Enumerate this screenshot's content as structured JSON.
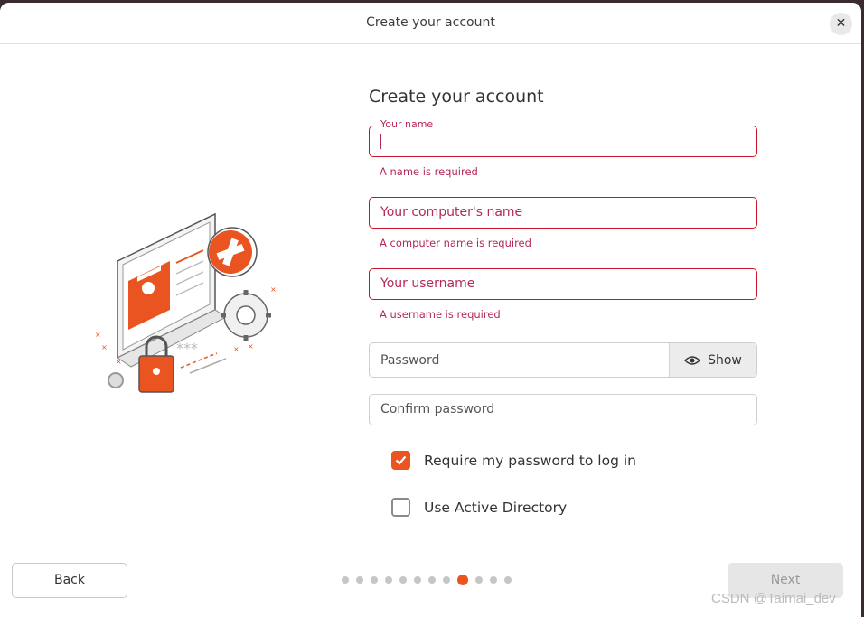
{
  "window": {
    "title": "Create your account"
  },
  "form": {
    "heading": "Create your account",
    "name": {
      "label": "Your name",
      "value": "",
      "error": "A name is required"
    },
    "computer": {
      "placeholder": "Your computer's name",
      "error": "A computer name is required"
    },
    "username": {
      "placeholder": "Your username",
      "error": "A username is required"
    },
    "password": {
      "placeholder": "Password",
      "show_label": "Show"
    },
    "confirm": {
      "placeholder": "Confirm password"
    },
    "require_password": {
      "label": "Require my password to log in",
      "checked": true
    },
    "active_directory": {
      "label": "Use Active Directory",
      "checked": false
    }
  },
  "footer": {
    "back_label": "Back",
    "next_label": "Next",
    "steps_total": 12,
    "current_step": 9
  },
  "watermark": "CSDN @Taimai_dev",
  "colors": {
    "accent": "#e95420",
    "error": "#c7162b"
  }
}
